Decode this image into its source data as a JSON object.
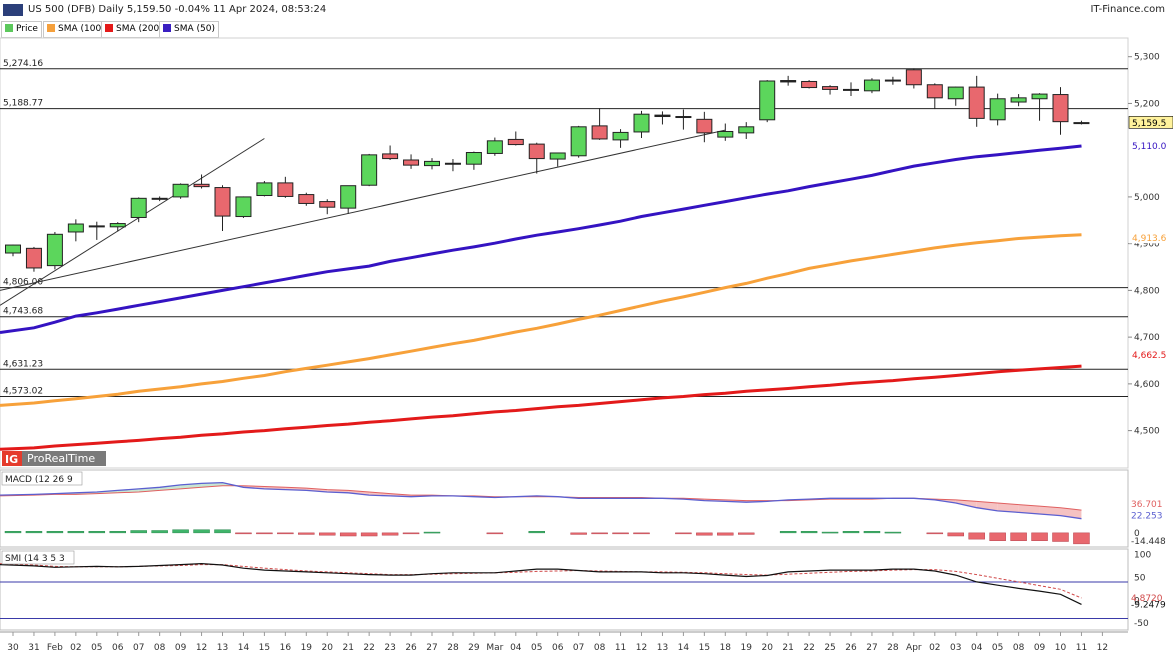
{
  "header": {
    "title": "US 500 (DFB) Daily 5,159.50 -0.04% 11 Apr 2024, 08:53:24",
    "source": "IT-Finance.com",
    "logo_label": "IG",
    "logo_text": "ProRealTime"
  },
  "legend": [
    {
      "label": "Price",
      "color": "#5cc85c"
    },
    {
      "label": "SMA (100)",
      "color": "#f5a03c"
    },
    {
      "label": "SMA (200)",
      "color": "#e41a1a"
    },
    {
      "label": "SMA (50)",
      "color": "#3a1fc1"
    }
  ],
  "colors": {
    "up": "#5cd65c",
    "down": "#e8686e",
    "sma50": "#3413c2",
    "sma100": "#f7a13a",
    "sma200": "#e31a1a",
    "macd_line": "#5b5fd0",
    "macd_signal": "#e06060",
    "macd_fill_down": "#f5c2c2",
    "macd_fill_up": "#c8e6d2"
  },
  "chart_data": [
    {
      "type": "candlestick",
      "title": "US 500 (DFB) Daily",
      "ylim": [
        4420,
        5340
      ],
      "y_ticks": [
        "5,300",
        "5,200",
        "5,000",
        "4,900",
        "4,800",
        "4,700",
        "4,600",
        "4,500"
      ],
      "x_tick_labels": [
        "30",
        "31",
        "Feb",
        "02",
        "05",
        "06",
        "07",
        "08",
        "09",
        "12",
        "13",
        "14",
        "15",
        "16",
        "19",
        "20",
        "21",
        "22",
        "23",
        "26",
        "27",
        "28",
        "29",
        "Mar",
        "04",
        "05",
        "06",
        "07",
        "08",
        "11",
        "12",
        "13",
        "14",
        "15",
        "18",
        "19",
        "20",
        "21",
        "22",
        "25",
        "26",
        "27",
        "28",
        "Apr",
        "02",
        "03",
        "04",
        "05",
        "08",
        "09",
        "10",
        "11",
        "12"
      ],
      "candles": [
        {
          "o": 4880,
          "h": 4898,
          "l": 4873,
          "c": 4897
        },
        {
          "o": 4890,
          "h": 4893,
          "l": 4840,
          "c": 4848
        },
        {
          "o": 4853,
          "h": 4925,
          "l": 4845,
          "c": 4920
        },
        {
          "o": 4925,
          "h": 4952,
          "l": 4905,
          "c": 4942
        },
        {
          "o": 4938,
          "h": 4947,
          "l": 4908,
          "c": 4938
        },
        {
          "o": 4936,
          "h": 4946,
          "l": 4926,
          "c": 4943
        },
        {
          "o": 4956,
          "h": 4999,
          "l": 4946,
          "c": 4997
        },
        {
          "o": 4995,
          "h": 5001,
          "l": 4991,
          "c": 4997
        },
        {
          "o": 5000,
          "h": 5029,
          "l": 4996,
          "c": 5027
        },
        {
          "o": 5027,
          "h": 5048,
          "l": 5018,
          "c": 5022
        },
        {
          "o": 5020,
          "h": 5025,
          "l": 4927,
          "c": 4959
        },
        {
          "o": 4958,
          "h": 5001,
          "l": 4955,
          "c": 5000
        },
        {
          "o": 5003,
          "h": 5034,
          "l": 5001,
          "c": 5030
        },
        {
          "o": 5030,
          "h": 5043,
          "l": 4998,
          "c": 5001
        },
        {
          "o": 5005,
          "h": 5009,
          "l": 4981,
          "c": 4986
        },
        {
          "o": 4990,
          "h": 4995,
          "l": 4963,
          "c": 4978
        },
        {
          "o": 4976,
          "h": 5022,
          "l": 4964,
          "c": 5024
        },
        {
          "o": 5025,
          "h": 5092,
          "l": 5023,
          "c": 5090
        },
        {
          "o": 5092,
          "h": 5110,
          "l": 5079,
          "c": 5082
        },
        {
          "o": 5079,
          "h": 5091,
          "l": 5060,
          "c": 5068
        },
        {
          "o": 5067,
          "h": 5083,
          "l": 5059,
          "c": 5076
        },
        {
          "o": 5072,
          "h": 5081,
          "l": 5055,
          "c": 5071
        },
        {
          "o": 5070,
          "h": 5097,
          "l": 5058,
          "c": 5095
        },
        {
          "o": 5093,
          "h": 5127,
          "l": 5088,
          "c": 5120
        },
        {
          "o": 5123,
          "h": 5140,
          "l": 5110,
          "c": 5112
        },
        {
          "o": 5113,
          "h": 5116,
          "l": 5050,
          "c": 5082
        },
        {
          "o": 5081,
          "h": 5095,
          "l": 5065,
          "c": 5094
        },
        {
          "o": 5088,
          "h": 5152,
          "l": 5084,
          "c": 5150
        },
        {
          "o": 5152,
          "h": 5190,
          "l": 5122,
          "c": 5124
        },
        {
          "o": 5122,
          "h": 5145,
          "l": 5105,
          "c": 5138
        },
        {
          "o": 5139,
          "h": 5184,
          "l": 5126,
          "c": 5177
        },
        {
          "o": 5175,
          "h": 5183,
          "l": 5155,
          "c": 5172
        },
        {
          "o": 5172,
          "h": 5187,
          "l": 5144,
          "c": 5172
        },
        {
          "o": 5166,
          "h": 5182,
          "l": 5117,
          "c": 5137
        },
        {
          "o": 5128,
          "h": 5157,
          "l": 5120,
          "c": 5140
        },
        {
          "o": 5137,
          "h": 5160,
          "l": 5124,
          "c": 5150
        },
        {
          "o": 5165,
          "h": 5250,
          "l": 5160,
          "c": 5248
        },
        {
          "o": 5249,
          "h": 5259,
          "l": 5238,
          "c": 5246
        },
        {
          "o": 5247,
          "h": 5250,
          "l": 5232,
          "c": 5234
        },
        {
          "o": 5236,
          "h": 5239,
          "l": 5219,
          "c": 5230
        },
        {
          "o": 5230,
          "h": 5245,
          "l": 5216,
          "c": 5230
        },
        {
          "o": 5227,
          "h": 5254,
          "l": 5222,
          "c": 5250
        },
        {
          "o": 5250,
          "h": 5257,
          "l": 5240,
          "c": 5250
        },
        {
          "o": 5272,
          "h": 5275,
          "l": 5232,
          "c": 5240
        },
        {
          "o": 5240,
          "h": 5243,
          "l": 5188,
          "c": 5212
        },
        {
          "o": 5210,
          "h": 5236,
          "l": 5195,
          "c": 5235
        },
        {
          "o": 5235,
          "h": 5259,
          "l": 5150,
          "c": 5168
        },
        {
          "o": 5165,
          "h": 5221,
          "l": 5153,
          "c": 5210
        },
        {
          "o": 5203,
          "h": 5220,
          "l": 5194,
          "c": 5212
        },
        {
          "o": 5210,
          "h": 5222,
          "l": 5163,
          "c": 5220
        },
        {
          "o": 5219,
          "h": 5235,
          "l": 5133,
          "c": 5161
        },
        {
          "o": 5159,
          "h": 5163,
          "l": 5155,
          "c": 5159
        }
      ],
      "sma50": [
        4710,
        4720,
        4732,
        4745,
        4752,
        4760,
        4768,
        4776,
        4784,
        4792,
        4800,
        4808,
        4816,
        4824,
        4832,
        4840,
        4846,
        4852,
        4862,
        4870,
        4878,
        4886,
        4893,
        4901,
        4910,
        4918,
        4925,
        4932,
        4940,
        4948,
        4958,
        4966,
        4974,
        4982,
        4990,
        4998,
        5006,
        5013,
        5022,
        5030,
        5038,
        5046,
        5056,
        5066,
        5073,
        5080,
        5086,
        5090,
        5095,
        5100,
        5104,
        5109
      ],
      "sma100": [
        4554,
        4559,
        4564,
        4568,
        4573,
        4578,
        4584,
        4589,
        4594,
        4600,
        4605,
        4612,
        4618,
        4626,
        4633,
        4640,
        4647,
        4654,
        4662,
        4670,
        4678,
        4686,
        4693,
        4702,
        4711,
        4719,
        4728,
        4738,
        4747,
        4757,
        4767,
        4777,
        4786,
        4796,
        4806,
        4815,
        4826,
        4836,
        4847,
        4855,
        4863,
        4870,
        4877,
        4884,
        4891,
        4897,
        4902,
        4906,
        4911,
        4914,
        4917,
        4919
      ],
      "sma200": [
        4460,
        4463,
        4467,
        4470,
        4473,
        4476,
        4479,
        4483,
        4486,
        4490,
        4493,
        4497,
        4500,
        4504,
        4507,
        4511,
        4514,
        4518,
        4521,
        4525,
        4529,
        4532,
        4536,
        4540,
        4543,
        4547,
        4551,
        4554,
        4558,
        4562,
        4566,
        4570,
        4573,
        4577,
        4580,
        4584,
        4587,
        4590,
        4594,
        4597,
        4601,
        4604,
        4607,
        4611,
        4614,
        4618,
        4622,
        4626,
        4629,
        4632,
        4635,
        4638
      ],
      "horizontal_levels": [
        {
          "value": 5274.16,
          "label": "5,274.16"
        },
        {
          "value": 5188.77,
          "label": "5,188.77"
        },
        {
          "value": 4806.0,
          "label": "4,806.00"
        },
        {
          "value": 4743.68,
          "label": "4,743.68"
        },
        {
          "value": 4631.23,
          "label": "4,631.23"
        },
        {
          "value": 4573.02,
          "label": "4,573.02"
        }
      ],
      "trendlines": [
        {
          "from": {
            "x": "30",
            "y": 4800
          },
          "to": {
            "x": "18",
            "y": 5143
          }
        },
        {
          "from": {
            "x": "30",
            "y": 4768
          },
          "to": {
            "x": "15",
            "y": 5125
          }
        }
      ],
      "value_tags": [
        {
          "label": "5,159.5",
          "value": 5159.5,
          "style": "price"
        },
        {
          "label": "5,110.0",
          "value": 5110.0,
          "style": "sma50"
        },
        {
          "label": "4,913.6",
          "value": 4913.6,
          "style": "sma100"
        },
        {
          "label": "4,662.5",
          "value": 4662.5,
          "style": "sma200"
        }
      ]
    },
    {
      "type": "macd",
      "title": "MACD (12 26 9",
      "ylim": [
        -18,
        80
      ],
      "macd": [
        48,
        49,
        50,
        51,
        52,
        54,
        56,
        58,
        61,
        63,
        64,
        58,
        56,
        55,
        54,
        52,
        51,
        48,
        47,
        46,
        47,
        47,
        46,
        45,
        46,
        47,
        46,
        44,
        44,
        44,
        44,
        44,
        43,
        41,
        40,
        39,
        40,
        42,
        43,
        44,
        44,
        44,
        44,
        44,
        42,
        38,
        32,
        28,
        26,
        24,
        22,
        18
      ],
      "signal": [
        47,
        48,
        49,
        49,
        50,
        51,
        52,
        54,
        56,
        58,
        60,
        60,
        59,
        58,
        57,
        55,
        54,
        52,
        50,
        48,
        48,
        47,
        47,
        46,
        46,
        46,
        46,
        45,
        45,
        45,
        45,
        44,
        44,
        43,
        42,
        41,
        41,
        41,
        42,
        43,
        43,
        43,
        44,
        44,
        43,
        42,
        40,
        38,
        36,
        34,
        32,
        29
      ],
      "histogram": [
        2,
        2,
        2,
        2,
        2,
        2,
        3,
        3,
        4,
        4,
        4,
        -1,
        -1,
        -1,
        -2,
        -3,
        -4,
        -4,
        -3,
        -1,
        1,
        0,
        0,
        -1,
        0,
        2,
        0,
        -2,
        -1,
        -1,
        -1,
        0,
        -1,
        -3,
        -3,
        -2,
        0,
        2,
        2,
        1,
        2,
        2,
        1,
        0,
        -1,
        -4,
        -8,
        -10,
        -10,
        -10,
        -11,
        -14
      ],
      "x_tick_labels": [
        "30",
        "31",
        "Feb",
        "02",
        "05",
        "06",
        "07",
        "08",
        "09",
        "12",
        "13",
        "14",
        "15",
        "16",
        "19",
        "20",
        "21",
        "22",
        "23",
        "26",
        "27",
        "28",
        "29",
        "Mar",
        "04",
        "05",
        "06",
        "07",
        "08",
        "11",
        "12",
        "13",
        "14",
        "15",
        "18",
        "19",
        "20",
        "21",
        "22",
        "25",
        "26",
        "27",
        "28",
        "Apr",
        "02",
        "03",
        "04",
        "05",
        "08",
        "09",
        "10",
        "11",
        "12"
      ],
      "y_ticks": [
        "0"
      ],
      "value_tags": [
        {
          "label": "36.701",
          "value": 36.7,
          "style": "signal"
        },
        {
          "label": "22.253",
          "value": 22.25,
          "style": "macd"
        },
        {
          "label": "-14.448",
          "value": -14.45,
          "style": "hist"
        }
      ]
    },
    {
      "type": "line",
      "title": "SMI (14 3 5 3",
      "ylim": [
        -65,
        112
      ],
      "smi": [
        78,
        75,
        72,
        73,
        74,
        73,
        74,
        76,
        78,
        80,
        77,
        70,
        66,
        64,
        62,
        60,
        58,
        56,
        55,
        55,
        58,
        60,
        60,
        60,
        64,
        68,
        68,
        65,
        62,
        62,
        62,
        60,
        60,
        58,
        55,
        52,
        54,
        62,
        64,
        66,
        66,
        66,
        68,
        68,
        64,
        55,
        40,
        33,
        26,
        20,
        13,
        -9
      ],
      "signal": [
        80,
        77,
        74,
        73,
        73,
        73,
        74,
        75,
        76,
        78,
        78,
        74,
        70,
        67,
        64,
        62,
        60,
        58,
        56,
        56,
        57,
        58,
        59,
        60,
        61,
        63,
        64,
        65,
        64,
        63,
        62,
        62,
        61,
        60,
        58,
        56,
        55,
        57,
        59,
        61,
        63,
        64,
        66,
        67,
        67,
        63,
        56,
        48,
        40,
        32,
        24,
        5
      ],
      "levels": [
        40,
        -40
      ],
      "y_ticks": [
        "100",
        "50",
        "0",
        "-50"
      ],
      "x_tick_labels": [
        "30",
        "31",
        "Feb",
        "02",
        "05",
        "06",
        "07",
        "08",
        "09",
        "12",
        "13",
        "14",
        "15",
        "16",
        "19",
        "20",
        "21",
        "22",
        "23",
        "26",
        "27",
        "28",
        "29",
        "Mar",
        "04",
        "05",
        "06",
        "07",
        "08",
        "11",
        "12",
        "13",
        "14",
        "15",
        "18",
        "19",
        "20",
        "21",
        "22",
        "25",
        "26",
        "27",
        "28",
        "Apr",
        "02",
        "03",
        "04",
        "05",
        "08",
        "09",
        "10",
        "11",
        "12"
      ],
      "value_tags": [
        {
          "label": "4.8720",
          "value": 4.872,
          "style": "signal"
        },
        {
          "label": "-9.2479",
          "value": -9.2479,
          "style": "smi"
        }
      ]
    }
  ]
}
